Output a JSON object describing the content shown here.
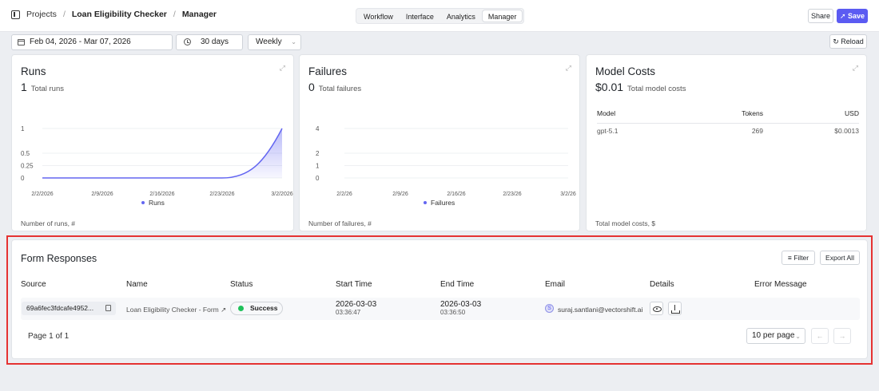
{
  "header": {
    "crumbs": [
      "Projects",
      "Loan Eligibility Checker",
      "Manager"
    ],
    "tabs": [
      "Workflow",
      "Interface",
      "Analytics",
      "Manager"
    ],
    "active_tab": "Manager",
    "share_label": "Share",
    "save_label": "Save"
  },
  "controls": {
    "date_range": "Feb 04, 2026 - Mar 07, 2026",
    "days": "30 days",
    "interval": "Weekly",
    "reload_label": "Reload"
  },
  "cards": {
    "runs": {
      "title": "Runs",
      "value": "1",
      "value_label": "Total runs",
      "footer": "Number of runs, #"
    },
    "failures": {
      "title": "Failures",
      "value": "0",
      "value_label": "Total failures",
      "footer": "Number of failures, #"
    },
    "costs": {
      "title": "Model Costs",
      "value": "$0.01",
      "value_label": "Total model costs",
      "footer": "Total model costs, $",
      "headers": {
        "model": "Model",
        "tokens": "Tokens",
        "usd": "USD"
      },
      "rows": [
        {
          "model": "gpt-5.1",
          "tokens": "269",
          "usd": "$0.0013"
        }
      ]
    }
  },
  "chart_data": [
    {
      "type": "area",
      "categories": [
        "2/2/2026",
        "2/9/2026",
        "2/16/2026",
        "2/23/2026",
        "3/2/2026"
      ],
      "series": [
        {
          "name": "Runs",
          "values": [
            0,
            0,
            0,
            0,
            1
          ]
        }
      ],
      "yticks": [
        "0",
        "0.25",
        "0.5",
        "1"
      ],
      "ylim": [
        0,
        1
      ],
      "color": "#6366f1",
      "legend": "bottom"
    },
    {
      "type": "line",
      "categories": [
        "2/2/26",
        "2/9/26",
        "2/16/26",
        "2/23/26",
        "3/2/26"
      ],
      "series": [
        {
          "name": "Failures",
          "values": [
            0,
            0,
            0,
            0,
            0
          ]
        }
      ],
      "yticks": [
        "0",
        "1",
        "2",
        "4"
      ],
      "ylim": [
        0,
        4
      ],
      "color": "#6366f1",
      "legend": "bottom"
    }
  ],
  "responses": {
    "title": "Form Responses",
    "filter_label": "Filter",
    "export_label": "Export All",
    "columns": [
      "Source",
      "Name",
      "Status",
      "Start Time",
      "End Time",
      "Email",
      "Details",
      "Error Message"
    ],
    "rows": [
      {
        "source": "69a6fec3fdcafe4952...",
        "name": "Loan Eligibility Checker - Form",
        "status": "Success",
        "start_date": "2026-03-03",
        "start_time": "03:36:47",
        "end_date": "2026-03-03",
        "end_time": "03:36:50",
        "avatar": "S",
        "email": "suraj.santlani@vectorshift.ai"
      }
    ],
    "page_label": "Page 1 of 1",
    "per_page": "10 per page"
  }
}
